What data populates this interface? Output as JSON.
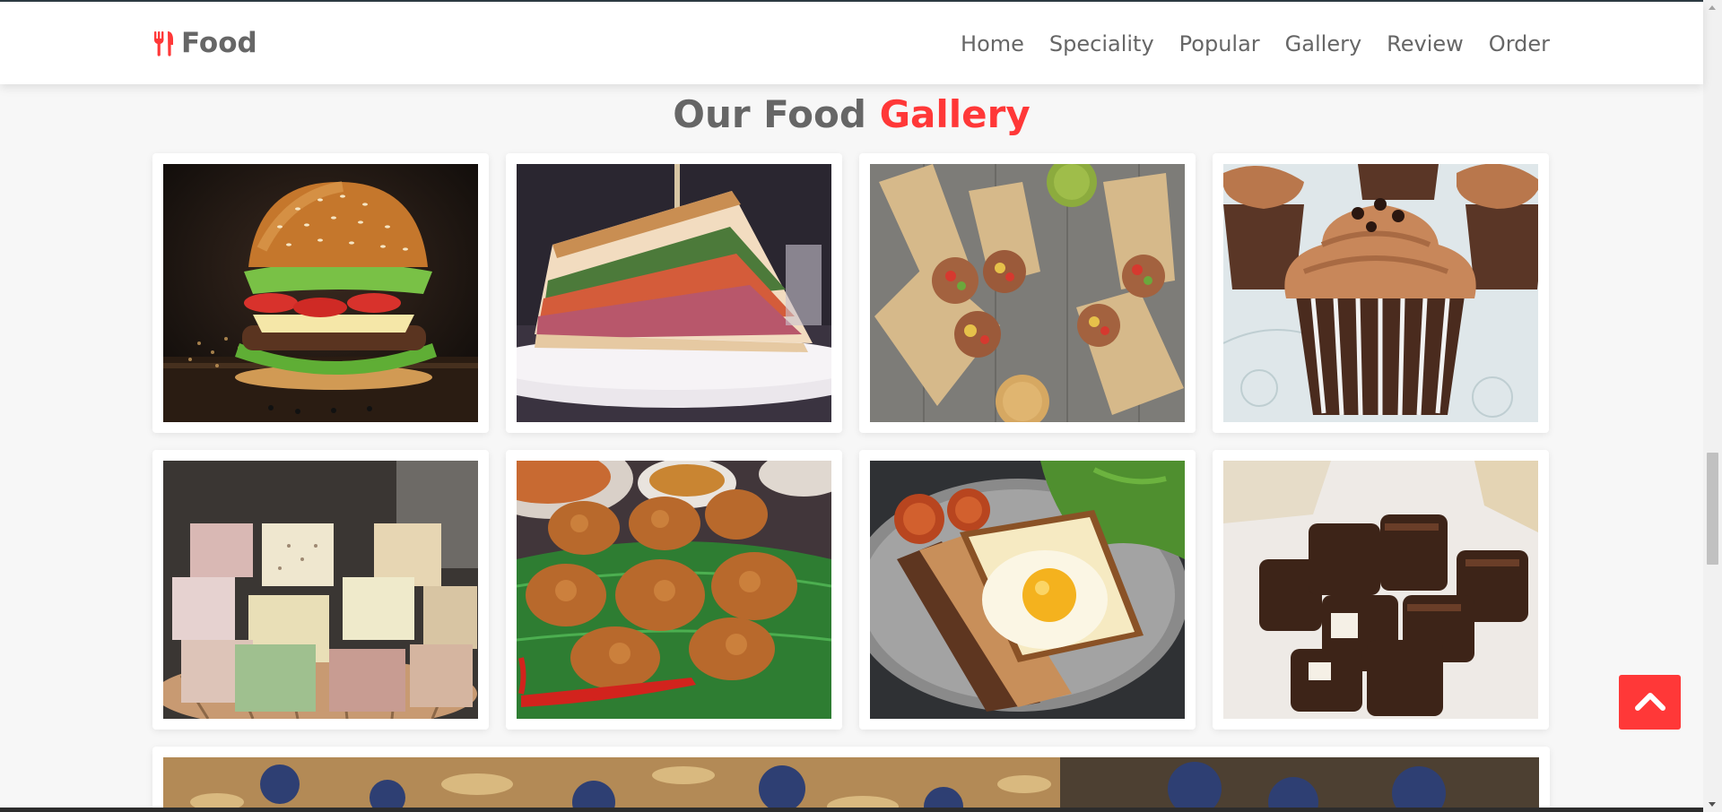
{
  "brand": {
    "logo_text": "Food",
    "logo_icon": "utensils-icon",
    "accent_color": "#ff3838"
  },
  "nav": {
    "items": [
      {
        "label": "Home"
      },
      {
        "label": "Speciality"
      },
      {
        "label": "Popular"
      },
      {
        "label": "Gallery"
      },
      {
        "label": "Review"
      },
      {
        "label": "Order"
      }
    ]
  },
  "section": {
    "title_main": "Our Food",
    "title_accent": "Gallery"
  },
  "gallery": {
    "items": [
      {
        "subject": "burger"
      },
      {
        "subject": "sandwich"
      },
      {
        "subject": "wraps"
      },
      {
        "subject": "cupcakes"
      },
      {
        "subject": "soap-like sweet cubes"
      },
      {
        "subject": "fried chicken"
      },
      {
        "subject": "egg on toast"
      },
      {
        "subject": "chocolate pieces"
      }
    ],
    "partial_item": {
      "subject": "blueberry baked goods"
    }
  },
  "scroll_top_button": {
    "icon": "chevron-up-icon"
  }
}
